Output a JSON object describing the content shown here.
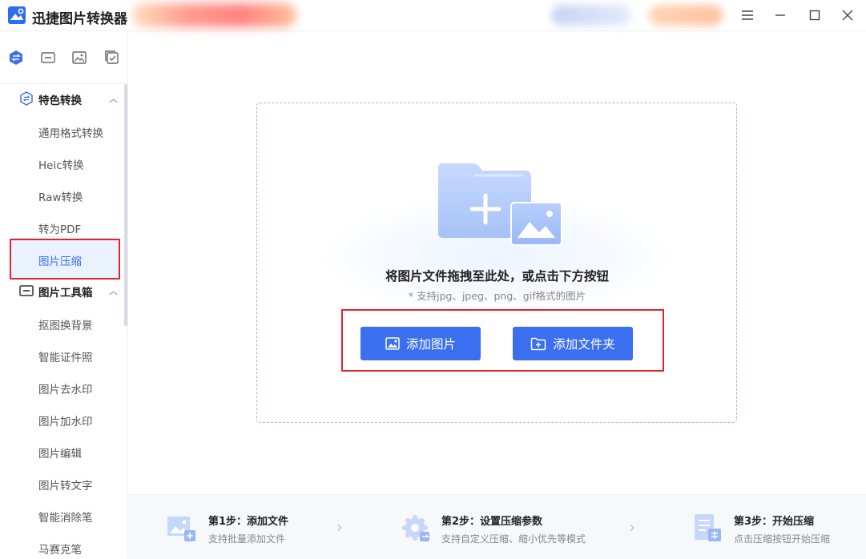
{
  "app": {
    "title": "迅捷图片转换器"
  },
  "window_controls": {
    "menu": "menu-icon",
    "minimize": "minimize-icon",
    "maximize": "maximize-icon",
    "close": "close-icon"
  },
  "sidebar": {
    "tabs": [
      "convert-tab-icon",
      "toolbox-tab-icon",
      "image-tab-icon",
      "check-tab-icon"
    ],
    "groups": [
      {
        "label": "特色转换",
        "items": [
          "通用格式转换",
          "Heic转换",
          "Raw转换",
          "转为PDF",
          "图片压缩"
        ]
      },
      {
        "label": "图片工具箱",
        "items": [
          "抠图换背景",
          "智能证件照",
          "图片去水印",
          "图片加水印",
          "图片编辑",
          "图片转文字",
          "智能消除笔",
          "马赛克笔"
        ]
      }
    ],
    "active_item": "图片压缩"
  },
  "dropzone": {
    "title": "将图片文件拖拽至此处，或点击下方按钮",
    "subtitle": "* 支持jpg、jpeg、png、gif格式的图片",
    "add_image_label": "添加图片",
    "add_folder_label": "添加文件夹"
  },
  "steps": [
    {
      "title": "第1步：添加文件",
      "desc": "支持批量添加文件"
    },
    {
      "title": "第2步：设置压缩参数",
      "desc": "支持自定义压缩、缩小优先等模式"
    },
    {
      "title": "第3步：开始压缩",
      "desc": "点击压缩按钮开始压缩"
    }
  ],
  "colors": {
    "accent": "#3a6ff0",
    "highlight": "#e3232c",
    "active_bg": "#eaf1ff"
  }
}
